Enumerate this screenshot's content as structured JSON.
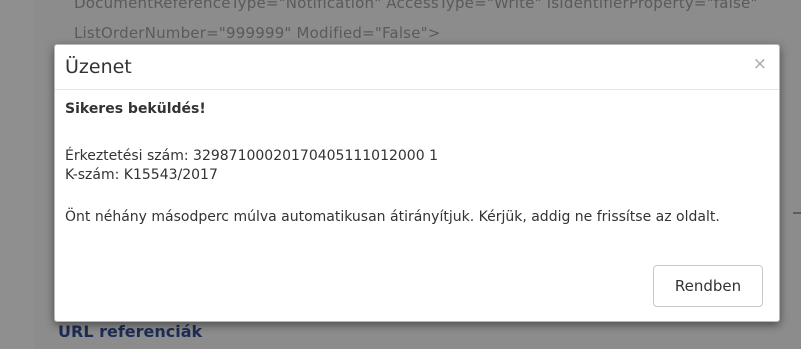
{
  "background": {
    "line1": "DocumentReferenceType=\"Notification\" AccessType=\"Write\" IsIdentifierProperty=\"false\"",
    "line2": "ListOrderNumber=\"999999\" Modified=\"False\">",
    "link": "URL referenciák"
  },
  "dialog": {
    "title": "Üzenet",
    "close_glyph": "×",
    "success": "Sikeres beküldés!",
    "registration": "Érkeztetési szám: 32987100020170405111012000 1",
    "k_number": "K-szám: K15543/2017",
    "redirect": "Önt néhány másodperc múlva automatikusan átirányítjuk. Kérjük, addig ne frissítse az oldalt.",
    "ok_label": "Rendben"
  }
}
